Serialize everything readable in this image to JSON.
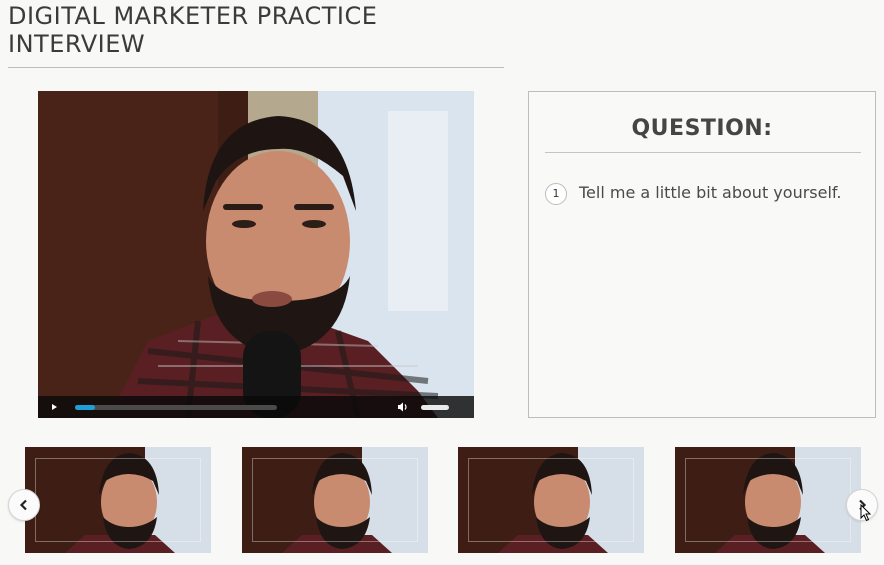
{
  "page": {
    "title": "DIGITAL MARKETER PRACTICE INTERVIEW"
  },
  "video_player": {
    "progress": 0.1,
    "volume": 1.0,
    "accent_color": "#1da0d8",
    "icons": {
      "play": "play-icon",
      "volume": "volume-icon"
    }
  },
  "question_panel": {
    "heading": "QUESTION:",
    "items": [
      {
        "number": "1",
        "text": "Tell me a little bit about yourself."
      }
    ]
  },
  "thumbnails": {
    "count": 4,
    "icons": {
      "prev": "chevron-left-icon",
      "next": "chevron-right-icon"
    }
  }
}
